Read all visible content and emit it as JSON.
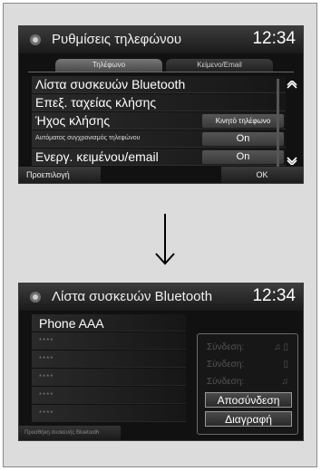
{
  "screen1": {
    "title": "Ρυθμίσεις τηλεφώνου",
    "clock": "12:34",
    "tabs": [
      {
        "label": "Τηλέφωνο",
        "active": true
      },
      {
        "label": "Κείμενο/Email",
        "active": false
      }
    ],
    "rows": [
      {
        "label": "Λίστα συσκευών Bluetooth",
        "value": ""
      },
      {
        "label": "Επεξ. ταχείας κλήσης",
        "value": ""
      },
      {
        "label": "Ήχος κλήσης",
        "value": "Κινητό τηλέφωνο"
      },
      {
        "label": "Αυτόματος συγχρονισμός τηλεφώνου",
        "value": "On"
      },
      {
        "label": "Ενεργ. κειμένου/email",
        "value": "On"
      }
    ],
    "scroll_up": "⌃",
    "scroll_down": "⌄",
    "default_button": "Προεπιλογή",
    "ok_button": "OK"
  },
  "screen2": {
    "title": "Λίστα συσκευών Bluetooth",
    "clock": "12:34",
    "devices": [
      "Phone AAA",
      "****",
      "****",
      "****",
      "****",
      "****"
    ],
    "popup": {
      "connect_items": [
        "Σύνδεση:",
        "Σύνδεση:",
        "Σύνδεση:"
      ],
      "connect_icons": [
        "♫ ▯",
        "▯",
        "♫"
      ],
      "disconnect_button": "Αποσύνδεση",
      "delete_button": "Διαγραφή"
    },
    "add_device_button": "Προσθήκη συσκευής Bluetooth"
  },
  "colors": {
    "screen_bg": "#111111",
    "frame_bg": "#dcdcdc",
    "text": "#ffffff",
    "dim_text": "#555555"
  }
}
